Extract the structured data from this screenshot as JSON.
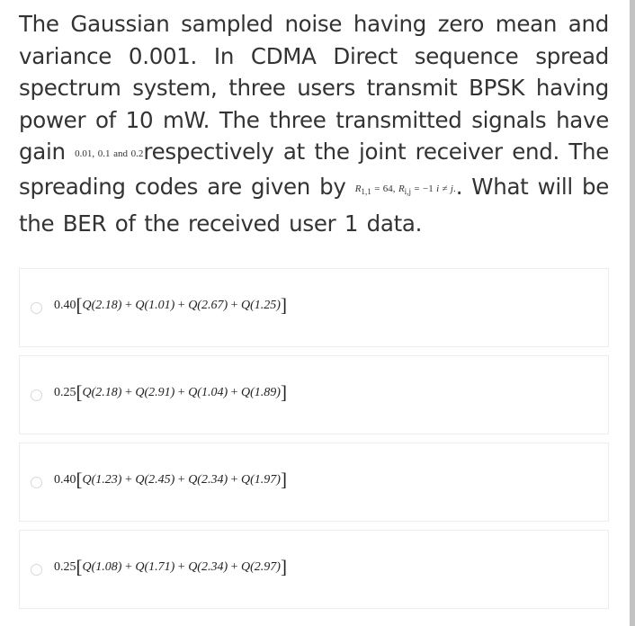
{
  "question": {
    "part1": "The Gaussian sampled noise having zero mean and variance 0.001. In CDMA Direct sequence spread spectrum system, three users transmit BPSK having power of 10 mW. The three transmitted signals have gain ",
    "gains_math": "0.01, 0.1 and 0.2",
    "part2": "respectively at the joint receiver end. The spreading codes are given by ",
    "codes_math": {
      "r11": "R",
      "r11_sub": "1,1",
      "r11_val": " = 64, ",
      "rij": "R",
      "rij_sub": "i,j",
      "rij_val": " = −1   ",
      "cond": "i ≠ j",
      "dot": "."
    },
    "part3": ". What will be the BER of the received user 1 data."
  },
  "options": [
    {
      "coef": "0.40",
      "terms": [
        "Q(2.18)",
        "Q(1.01)",
        "Q(2.67)",
        "Q(1.25)"
      ]
    },
    {
      "coef": "0.25",
      "terms": [
        "Q(2.18)",
        "Q(2.91)",
        "Q(1.04)",
        "Q(1.89)"
      ]
    },
    {
      "coef": "0.40",
      "terms": [
        "Q(1.23)",
        "Q(2.45)",
        "Q(2.34)",
        "Q(1.97)"
      ]
    },
    {
      "coef": "0.25",
      "terms": [
        "Q(1.08)",
        "Q(1.71)",
        "Q(2.34)",
        "Q(2.97)"
      ]
    }
  ],
  "symbols": {
    "plus": " + ",
    "lbracket": "[",
    "rbracket": "]"
  }
}
